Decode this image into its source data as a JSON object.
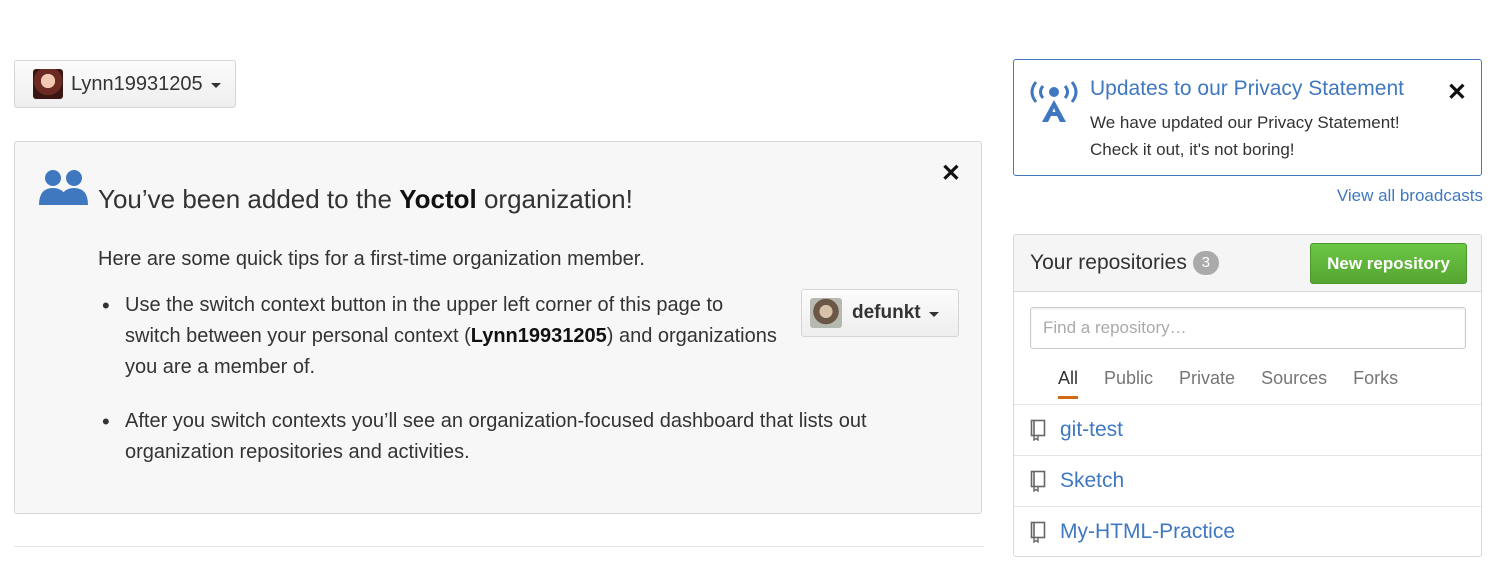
{
  "context": {
    "username": "Lynn19931205"
  },
  "org_notice": {
    "title_prefix": "You’ve been added to the ",
    "org_name": "Yoctol",
    "title_suffix": " organization!",
    "intro": "Here are some quick tips for a first-time organization member.",
    "tip1_before": "Use the switch context button in the upper left corner of this page to switch between your personal context (",
    "tip1_user": "Lynn19931205",
    "tip1_after": ") and organizations you are a member of.",
    "tip2": "After you switch contexts you’ll see an organization-focused dashboard that lists out organization repositories and activities.",
    "example_button": "defunkt",
    "close_glyph": "✕"
  },
  "broadcast": {
    "title": "Updates to our Privacy Statement",
    "line1": "We have updated our Privacy Statement!",
    "line2": "Check it out, it's not boring!",
    "close_glyph": "✕",
    "view_all": "View all broadcasts"
  },
  "repos": {
    "title": "Your repositories",
    "count": "3",
    "new_button": "New repository",
    "search_placeholder": "Find a repository…",
    "tabs": [
      {
        "label": "All",
        "active": true
      },
      {
        "label": "Public"
      },
      {
        "label": "Private"
      },
      {
        "label": "Sources"
      },
      {
        "label": "Forks"
      }
    ],
    "items": [
      {
        "name": "git-test"
      },
      {
        "name": "Sketch"
      },
      {
        "name": "My-HTML-Practice"
      }
    ]
  },
  "colors": {
    "link": "#4078c0",
    "green": "#6cc644",
    "tab_active": "#d26911"
  }
}
